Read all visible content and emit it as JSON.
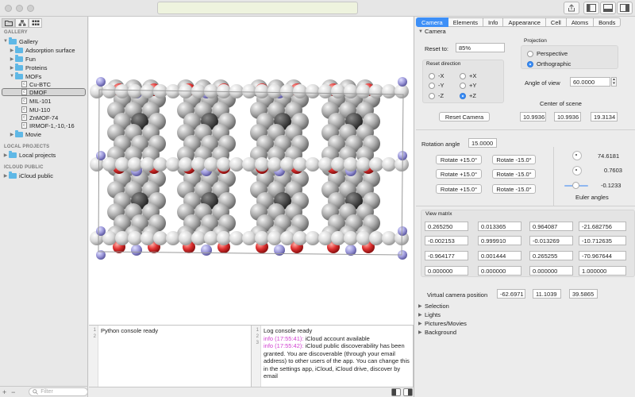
{
  "sidebar": {
    "sections": {
      "gallery": "GALLERY",
      "local": "LOCAL PROJECTS",
      "icloud": "ICLOUD PUBLIC"
    },
    "tree": [
      {
        "label": "Gallery"
      },
      {
        "label": "Adsorption surface"
      },
      {
        "label": "Fun"
      },
      {
        "label": "Proteins"
      },
      {
        "label": "MOFs"
      },
      {
        "label": "Cu-BTC"
      },
      {
        "label": "DMOF"
      },
      {
        "label": "MIL-101"
      },
      {
        "label": "MU-110"
      },
      {
        "label": "ZnMOF-74"
      },
      {
        "label": "IRMOF-1,-10,-16"
      },
      {
        "label": "Movie"
      },
      {
        "label": "Local projects"
      },
      {
        "label": "iCloud public"
      }
    ],
    "filter_placeholder": "Filter",
    "add_label": "+",
    "remove_label": "−"
  },
  "console": {
    "python": {
      "line_numbers": "1\n2",
      "text": "Python console ready"
    },
    "log": {
      "line_numbers": "1\n2\n3",
      "ready": "Log console ready",
      "entries": [
        {
          "prefix": "info (17:55:41):",
          "text": " iCloud account available"
        },
        {
          "prefix": "info (17:55:42):",
          "text": " iCloud public discoverability has been granted. You are discoverable (through your email address) to other users of the app. You can change this in the settings app, iCloud, iCloud drive, discover by email"
        }
      ]
    }
  },
  "inspector": {
    "tabs": [
      "Camera",
      "Elements",
      "Info",
      "Appearance",
      "Cell",
      "Atoms",
      "Bonds"
    ],
    "camera_header": "Camera",
    "reset_to_label": "Reset to:",
    "reset_to_value": "85%",
    "reset_direction_label": "Reset direction",
    "directions": [
      "-X",
      "+X",
      "-Y",
      "+Y",
      "-Z",
      "+Z"
    ],
    "selected_direction": "+Z",
    "reset_camera_button": "Reset Camera",
    "projection_label": "Projection",
    "projection_options": [
      "Perspective",
      "Orthographic"
    ],
    "selected_projection": "Orthographic",
    "angle_of_view_label": "Angle of view",
    "angle_of_view_value": "60.0000",
    "center_of_scene_label": "Center of scene",
    "center_of_scene": [
      "10.9936",
      "10.9936",
      "19.3134"
    ],
    "rotation_angle_label": "Rotation angle",
    "rotation_angle_value": "15.0000",
    "rotate_buttons": [
      "Rotate +15.0°",
      "Rotate -15.0°",
      "Rotate +15.0°",
      "Rotate -15.0°",
      "Rotate +15.0°",
      "Rotate -15.0°"
    ],
    "euler_values": [
      "74.6181",
      "0.7603",
      "-0.1233"
    ],
    "euler_label": "Euler angles",
    "view_matrix_label": "View matrix",
    "view_matrix": [
      [
        "0.265250",
        "0.013365",
        "0.964087",
        "-21.682756"
      ],
      [
        "-0.002153",
        "0.999910",
        "-0.013269",
        "-10.712635"
      ],
      [
        "-0.964177",
        "0.001444",
        "0.265255",
        "-70.967644"
      ],
      [
        "0.000000",
        "0.000000",
        "0.000000",
        "1.000000"
      ]
    ],
    "virtual_camera_label": "Virtual camera position",
    "virtual_camera_position": [
      "-62.6971",
      "11.1039",
      "39.5865"
    ],
    "collapsed_sections": [
      "Selection",
      "Lights",
      "Pictures/Movies",
      "Background"
    ]
  }
}
